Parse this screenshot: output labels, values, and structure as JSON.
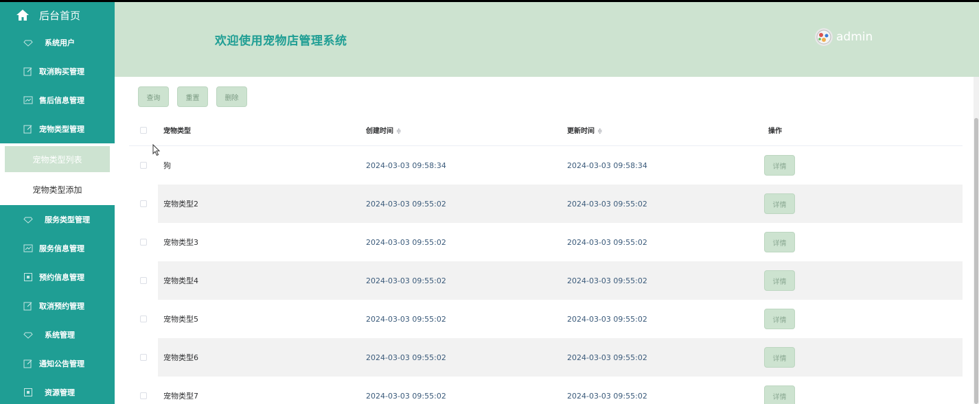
{
  "sidebar": {
    "home_label": "后台首页",
    "items": [
      {
        "label": "系统用户",
        "icon": "diamond-icon"
      },
      {
        "label": "取消购买管理",
        "icon": "edit-icon"
      },
      {
        "label": "售后信息管理",
        "icon": "chart-icon"
      },
      {
        "label": "宠物类型管理",
        "icon": "edit-icon"
      }
    ],
    "sub_items": [
      {
        "label": "宠物类型列表",
        "active": true
      },
      {
        "label": "宠物类型添加",
        "active": false
      }
    ],
    "items_after": [
      {
        "label": "服务类型管理",
        "icon": "diamond-icon"
      },
      {
        "label": "服务信息管理",
        "icon": "chart-icon"
      },
      {
        "label": "预约信息管理",
        "icon": "calendar-icon"
      },
      {
        "label": "取消预约管理",
        "icon": "edit-icon"
      },
      {
        "label": "系统管理",
        "icon": "diamond-icon"
      },
      {
        "label": "通知公告管理",
        "icon": "edit-icon"
      },
      {
        "label": "资源管理",
        "icon": "calendar-icon"
      }
    ]
  },
  "header": {
    "title": "欢迎使用宠物店管理系统",
    "username": "admin"
  },
  "toolbar": {
    "query_label": "查询",
    "reset_label": "重置",
    "delete_label": "删除"
  },
  "table": {
    "headers": {
      "type": "宠物类型",
      "created": "创建时间",
      "updated": "更新时间",
      "op": "操作"
    },
    "sort_glyph": "≑",
    "detail_label": "详情",
    "rows": [
      {
        "type": "狗",
        "created": "2024-03-03 09:58:34",
        "updated": "2024-03-03 09:58:34"
      },
      {
        "type": "宠物类型2",
        "created": "2024-03-03 09:55:02",
        "updated": "2024-03-03 09:55:02"
      },
      {
        "type": "宠物类型3",
        "created": "2024-03-03 09:55:02",
        "updated": "2024-03-03 09:55:02"
      },
      {
        "type": "宠物类型4",
        "created": "2024-03-03 09:55:02",
        "updated": "2024-03-03 09:55:02"
      },
      {
        "type": "宠物类型5",
        "created": "2024-03-03 09:55:02",
        "updated": "2024-03-03 09:55:02"
      },
      {
        "type": "宠物类型6",
        "created": "2024-03-03 09:55:02",
        "updated": "2024-03-03 09:55:02"
      },
      {
        "type": "宠物类型7",
        "created": "2024-03-03 09:55:02",
        "updated": "2024-03-03 09:55:02"
      }
    ]
  },
  "colors": {
    "sidebar_bg": "#1f9e94",
    "header_bg": "#cde3d0",
    "title_color": "#1f9e94",
    "button_bg": "#cde3d0"
  }
}
